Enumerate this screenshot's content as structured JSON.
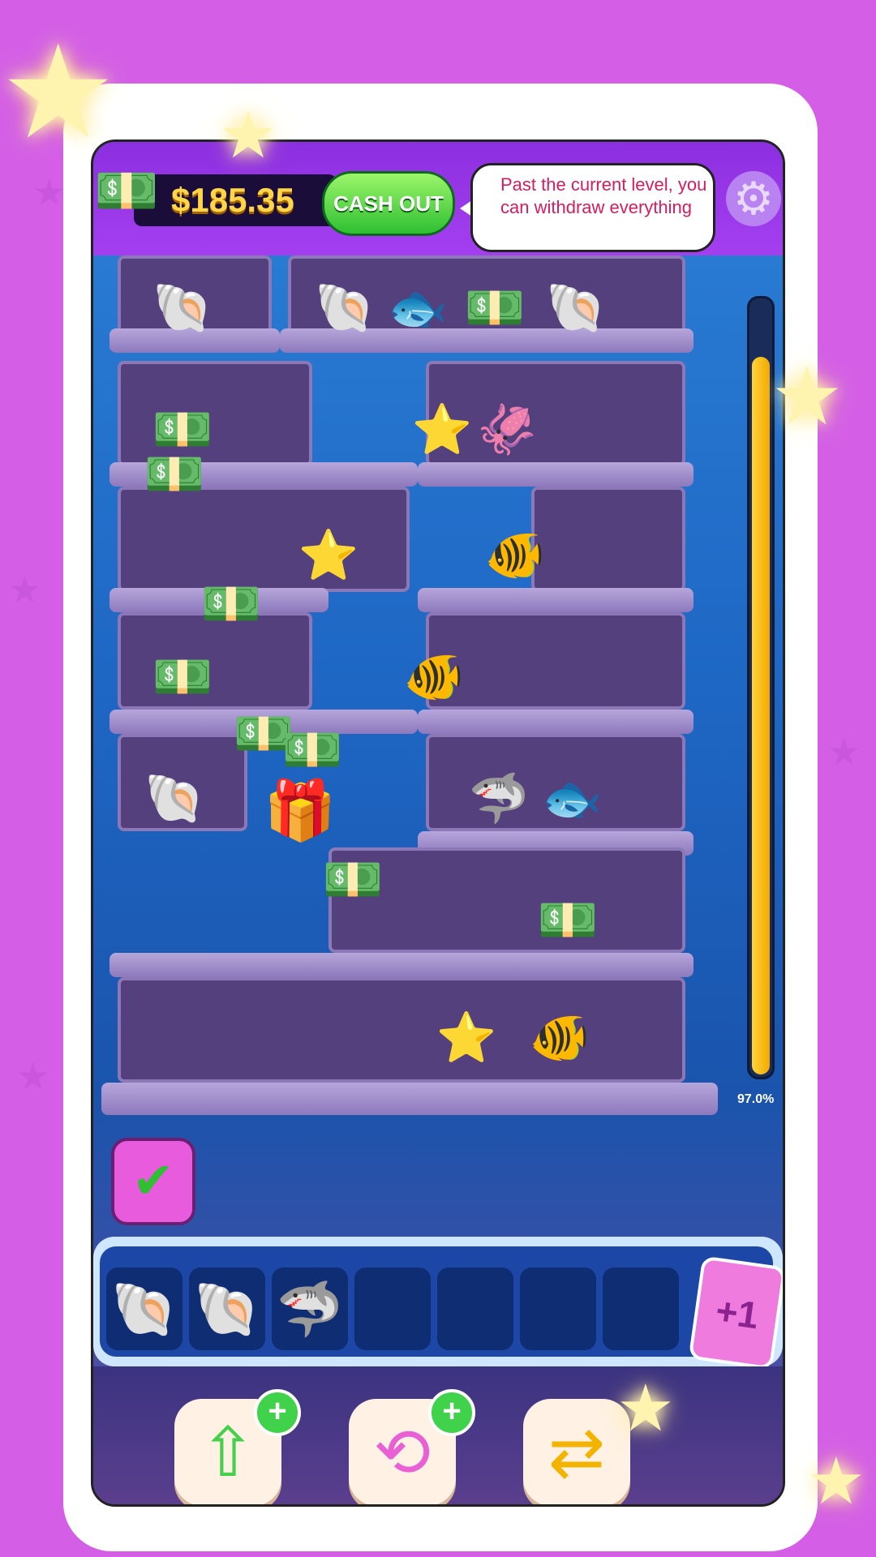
{
  "balance": "$185.35",
  "cash_out_label": "CASH OUT",
  "tooltip": "Past the current level, you can withdraw everything",
  "progress": {
    "percent": 97.0,
    "label": "97.0%"
  },
  "tray": {
    "slots": [
      "shell-icon",
      "shell-icon",
      "shark-icon",
      "",
      "",
      "",
      ""
    ],
    "extra_slot_label": "+1"
  },
  "powerups": [
    {
      "name": "undo-arrow-up",
      "label": "+"
    },
    {
      "name": "rotate-arrow",
      "label": "+"
    },
    {
      "name": "shuffle-arrow",
      "label": ""
    }
  ],
  "colors": {
    "accent": "#2fbf32",
    "balance": "#ffd54a",
    "tooltip_text": "#d81b60",
    "progress": "#ffd33a"
  }
}
